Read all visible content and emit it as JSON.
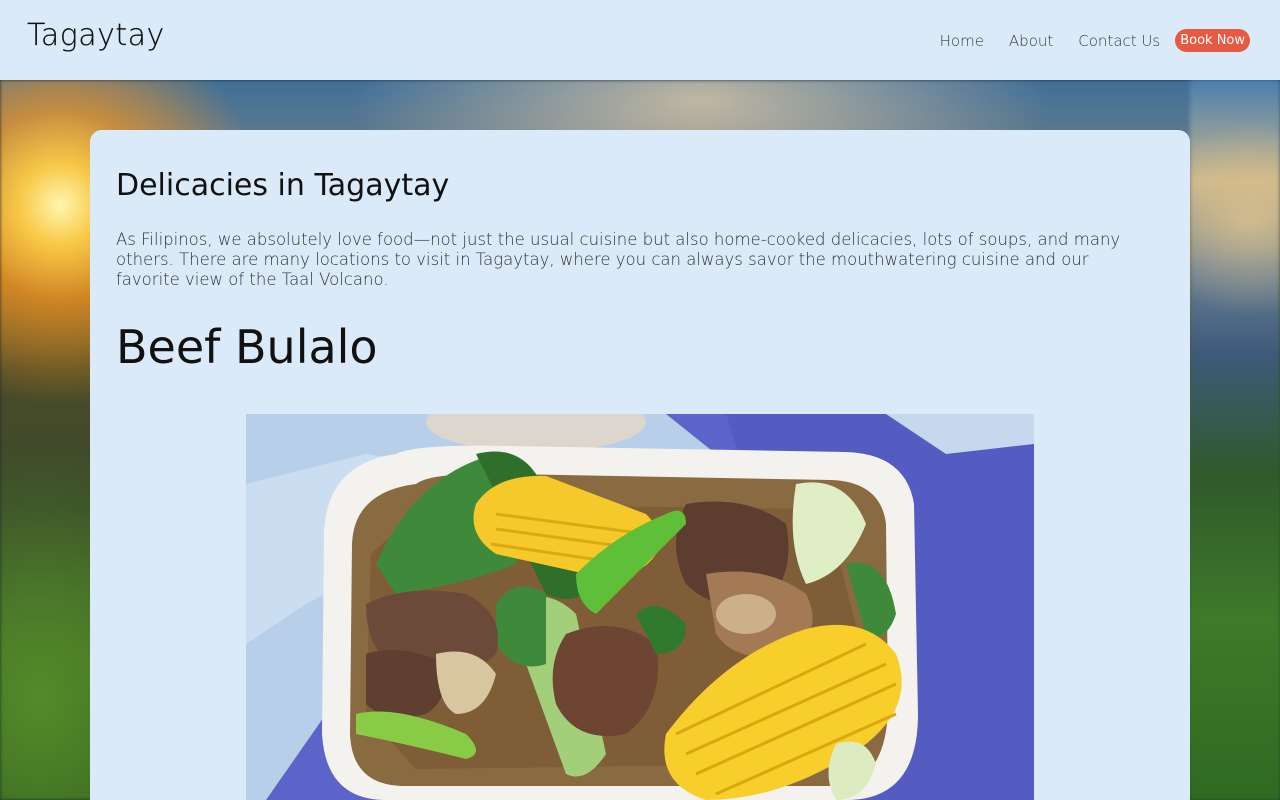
{
  "header": {
    "logo": "Tagaytay",
    "nav": [
      {
        "label": "Home"
      },
      {
        "label": "About"
      },
      {
        "label": "Contact Us"
      }
    ],
    "cta_label": "Book Now"
  },
  "content": {
    "section_title": "Delicacies in Tagaytay",
    "intro": "As Filipinos, we absolutely love food—not just the usual cuisine but also home-cooked delicacies, lots of soups, and many others. There are many locations to visit in Tagaytay, where you can always savor the mouthwatering cuisine and our favorite view of the Taal Volcano.",
    "dish_title": "Beef Bulalo"
  },
  "colors": {
    "header_bg": "#dbeaf9",
    "card_bg": "#dbeaf9",
    "cta_bg": "#e65a44",
    "cta_text": "#ffffff"
  }
}
